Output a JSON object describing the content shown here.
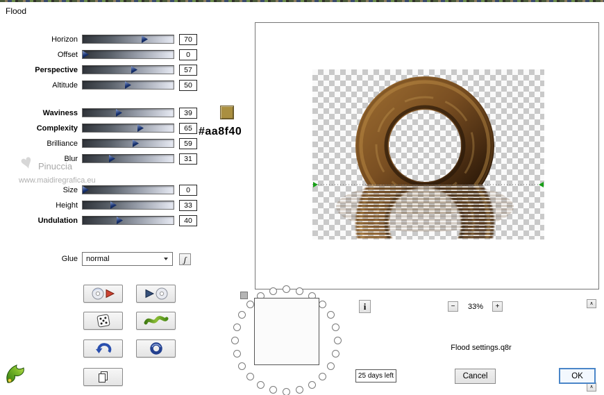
{
  "window": {
    "title": "Flood"
  },
  "sliders": [
    {
      "label": "Horizon",
      "value": 70,
      "bold": false
    },
    {
      "label": "Offset",
      "value": 0,
      "bold": false
    },
    {
      "label": "Perspective",
      "value": 57,
      "bold": true
    },
    {
      "label": "Altitude",
      "value": 50,
      "bold": false
    },
    {
      "label": "Waviness",
      "value": 39,
      "bold": true
    },
    {
      "label": "Complexity",
      "value": 65,
      "bold": true
    },
    {
      "label": "Brilliance",
      "value": 59,
      "bold": false
    },
    {
      "label": "Blur",
      "value": 31,
      "bold": false
    },
    {
      "label": "Size",
      "value": 0,
      "bold": false
    },
    {
      "label": "Height",
      "value": 33,
      "bold": false
    },
    {
      "label": "Undulation",
      "value": 40,
      "bold": true
    }
  ],
  "glue": {
    "label": "Glue",
    "value": "normal"
  },
  "color": {
    "swatch": "#aa8f40",
    "hex_label": "#aa8f40"
  },
  "watermark": {
    "heart": "♥",
    "name": "Pinuccia",
    "url": "www.maidiregrafica.eu"
  },
  "preview": {
    "zoom_value": "33%",
    "settings_name": "Flood settings.q8r"
  },
  "trial_label": "25 days left",
  "actions": {
    "cancel": "Cancel",
    "ok": "OK"
  },
  "icons": {
    "glue_options": "ʃ",
    "info": "i",
    "zoom_out": "−",
    "zoom_in": "+",
    "spinner_up": "∧"
  }
}
